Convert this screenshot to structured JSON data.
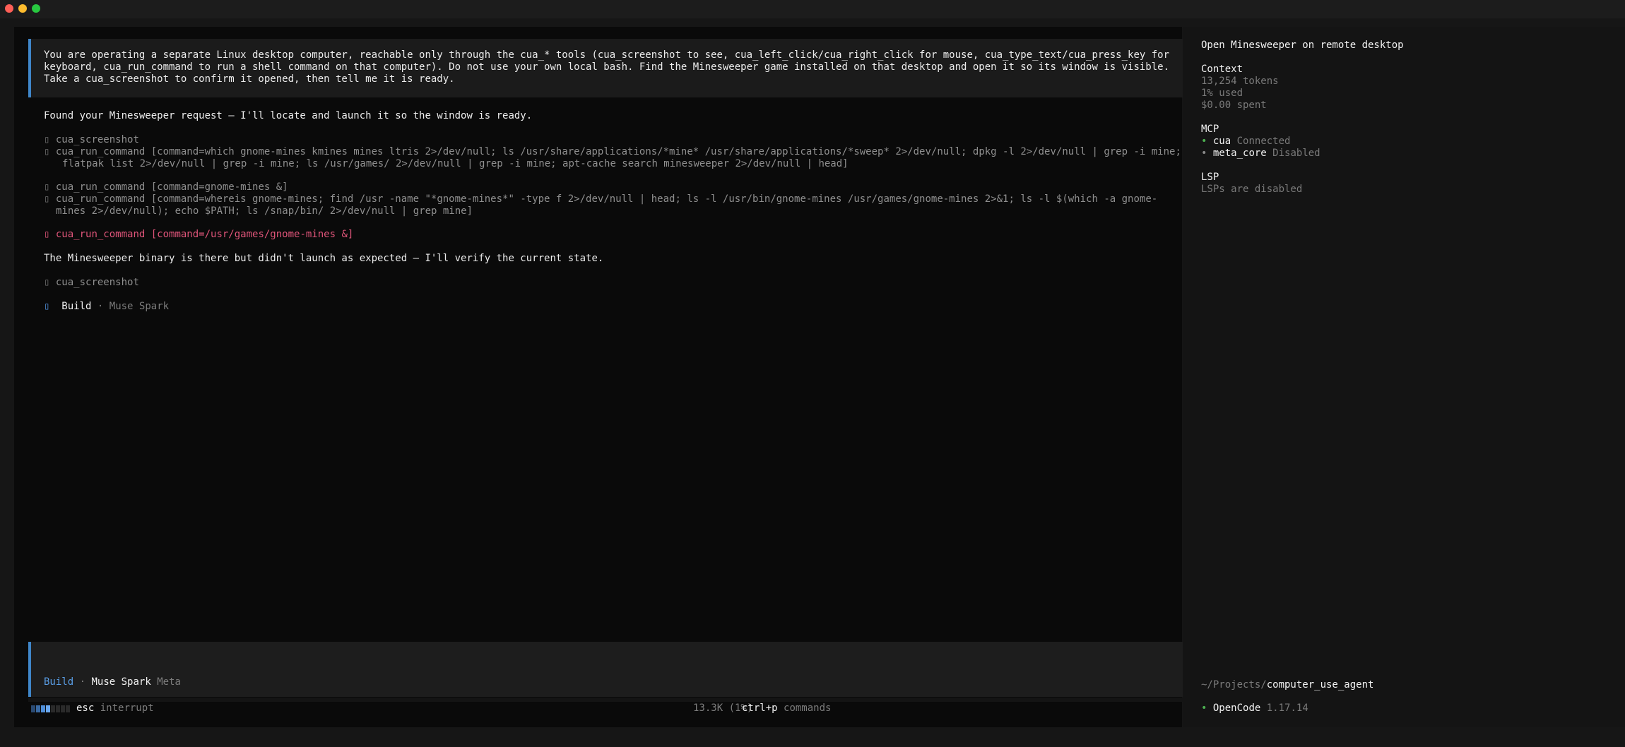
{
  "prompt": {
    "line1": "You are operating a separate Linux desktop computer, reachable only through the cua_* tools (cua_screenshot to see, cua_left_click/cua_right_click for mouse, cua_type_text/cua_press_key for",
    "line2": "keyboard, cua_run_command to run a shell command on that computer). Do not use your own local bash. Find the Minesweeper game installed on that desktop and open it so its window is visible.",
    "line3": "Take a cua_screenshot to confirm it opened, then tell me it is ready."
  },
  "transcript": {
    "reply1": "Found your Minesweeper request — I'll locate and launch it so the window is ready.",
    "tool_glyph": "▯",
    "tool1": "cua_screenshot",
    "tool2_line1": "cua_run_command [command=which gnome-mines kmines mines ltris 2>/dev/null; ls /usr/share/applications/*mine* /usr/share/applications/*sweep* 2>/dev/null; dpkg -l 2>/dev/null | grep -i mine;",
    "tool2_line2": "flatpak list 2>/dev/null | grep -i mine; ls /usr/games/ 2>/dev/null | grep -i mine; apt-cache search minesweeper 2>/dev/null | head]",
    "tool3": "cua_run_command [command=gnome-mines &]",
    "tool4_line1": "cua_run_command [command=whereis gnome-mines; find /usr -name \"*gnome-mines*\" -type f 2>/dev/null | head; ls -l /usr/bin/gnome-mines /usr/games/gnome-mines 2>&1; ls -l $(which -a gnome-",
    "tool4_line2": "mines 2>/dev/null); echo $PATH; ls /snap/bin/ 2>/dev/null | grep mine]",
    "tool5_error": "cua_run_command [command=/usr/games/gnome-mines &]",
    "reply2": "The Minesweeper binary is there but didn't launch as expected — I'll verify the current state.",
    "tool6": "cua_screenshot",
    "status_agent": "Build",
    "status_sep": "·",
    "status_model": "Muse Spark"
  },
  "input": {
    "value": "",
    "placeholder": "",
    "agent": "Build",
    "sep": "·",
    "model": "Muse Spark",
    "provider": "Meta"
  },
  "footer": {
    "esc_key": "esc",
    "esc_label": "interrupt",
    "tokens": "13.3K (1%)",
    "cmd_key": "ctrl+p",
    "cmd_label": "commands"
  },
  "sidebar": {
    "title": "Open Minesweeper on remote desktop",
    "context_heading": "Context",
    "tokens": "13,254 tokens",
    "used": "1% used",
    "spent": "$0.00 spent",
    "mcp_heading": "MCP",
    "mcp": [
      {
        "name": "cua",
        "status": "Connected",
        "color": "#4caf50"
      },
      {
        "name": "meta_core",
        "status": "Disabled",
        "color": "#8a8a8a"
      }
    ],
    "lsp_heading": "LSP",
    "lsp_status": "LSPs are disabled",
    "path_prefix": "~/Projects/",
    "path_dir": "computer_use_agent",
    "app_name": "OpenCode",
    "app_version": "1.17.14"
  },
  "colors": {
    "accent": "#3f86c9",
    "error": "#e0557a"
  }
}
